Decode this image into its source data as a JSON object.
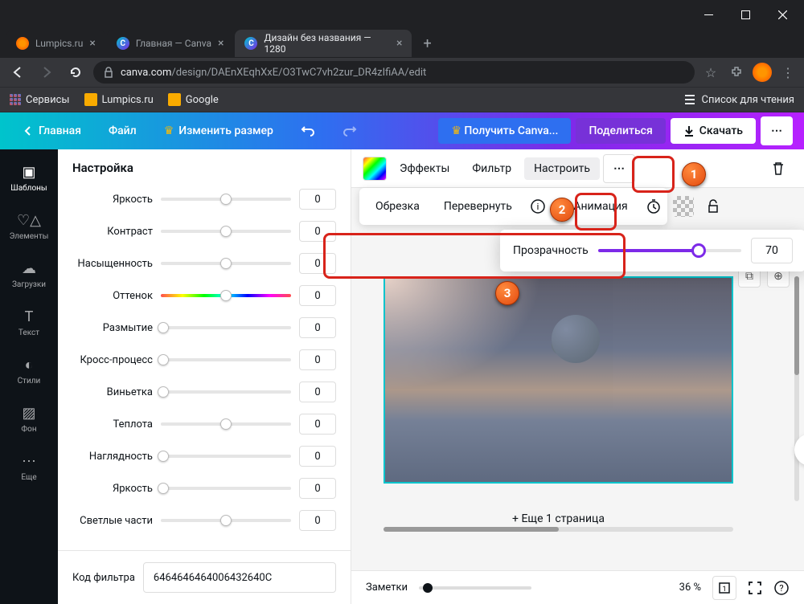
{
  "browser": {
    "tabs": [
      {
        "title": "Lumpics.ru"
      },
      {
        "title": "Главная — Canva"
      },
      {
        "title": "Дизайн без названия — 1280"
      }
    ],
    "url_prefix": "canva.com",
    "url_path": "/design/DAEnXEqhXxE/O3TwC7vh2zur_DR4zIfiAA/edit",
    "bookmarks": {
      "services": "Сервисы",
      "lumpics": "Lumpics.ru",
      "google": "Google",
      "reading_list": "Список для чтения"
    }
  },
  "appbar": {
    "home": "Главная",
    "file": "Файл",
    "resize": "Изменить размер",
    "get_pro": "Получить Canva...",
    "share": "Поделиться",
    "download": "Скачать"
  },
  "sidenav": [
    {
      "label": "Шаблоны"
    },
    {
      "label": "Элементы"
    },
    {
      "label": "Загрузки"
    },
    {
      "label": "Текст"
    },
    {
      "label": "Стили"
    },
    {
      "label": "Фон"
    },
    {
      "label": "Еще"
    }
  ],
  "panel": {
    "title": "Настройка",
    "sliders": [
      {
        "label": "Яркость",
        "value": "0",
        "pos": 50
      },
      {
        "label": "Контраст",
        "value": "0",
        "pos": 50
      },
      {
        "label": "Насыщенность",
        "value": "0",
        "pos": 50
      },
      {
        "label": "Оттенок",
        "value": "0",
        "pos": 50,
        "hue": true
      },
      {
        "label": "Размытие",
        "value": "0",
        "pos": 2
      },
      {
        "label": "Кросс-процесс",
        "value": "0",
        "pos": 2
      },
      {
        "label": "Виньетка",
        "value": "0",
        "pos": 2
      },
      {
        "label": "Теплота",
        "value": "0",
        "pos": 50
      },
      {
        "label": "Наглядность",
        "value": "0",
        "pos": 2
      },
      {
        "label": "Яркость",
        "value": "0",
        "pos": 2
      },
      {
        "label": "Светлые части",
        "value": "0",
        "pos": 50
      }
    ],
    "filter_code_label": "Код фильтра",
    "filter_code_value": "6464646464006432640C"
  },
  "context_bar": {
    "effects": "Эффекты",
    "filter": "Фильтр",
    "adjust": "Настроить"
  },
  "float_toolbar": {
    "crop": "Обрезка",
    "flip": "Перевернуть",
    "animate": "Анимация"
  },
  "popover": {
    "label": "Прозрачность",
    "value": "70"
  },
  "canvas": {
    "add_page": "+ Еще 1 страница"
  },
  "bottom": {
    "notes": "Заметки",
    "zoom": "36 %"
  }
}
